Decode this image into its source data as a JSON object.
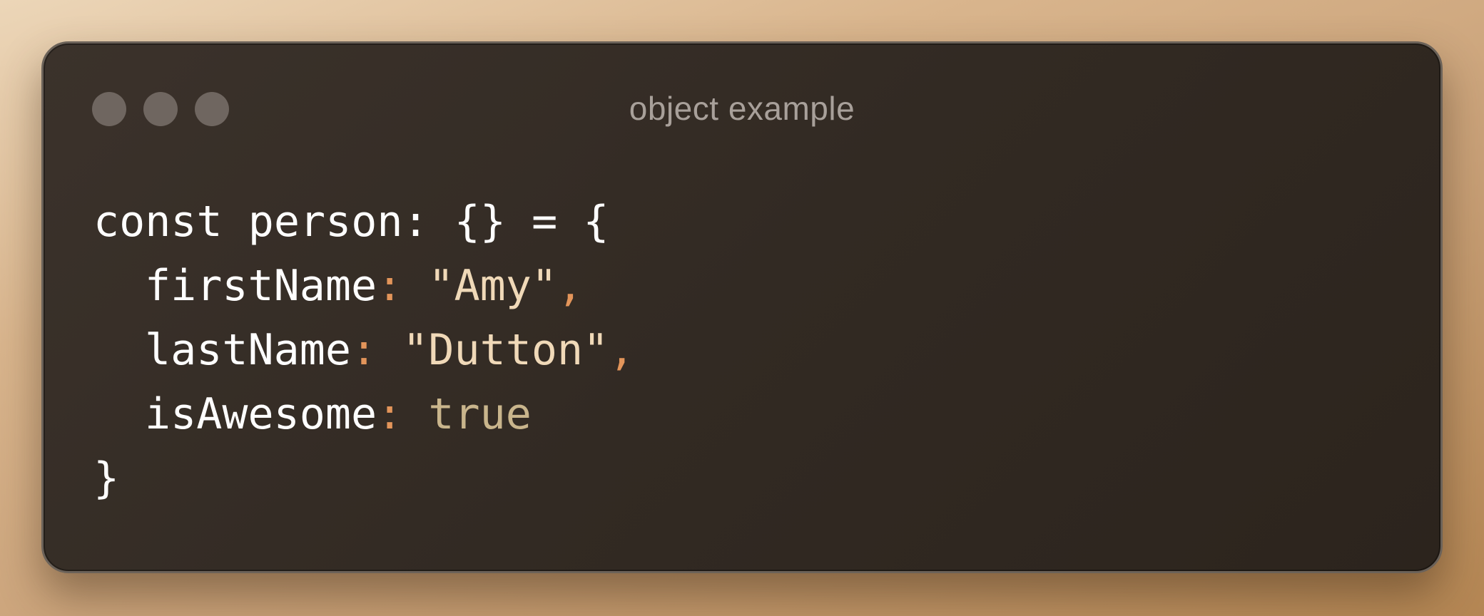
{
  "window": {
    "title": "object example",
    "traffic_lights": [
      "close-light",
      "minimize-light",
      "zoom-light"
    ]
  },
  "code": {
    "line1": "const person: {} = {",
    "line2_key": "firstName",
    "line2_colon": ":",
    "line2_value": "\"Amy\"",
    "line2_comma": ",",
    "line3_key": "lastName",
    "line3_colon": ":",
    "line3_value": "\"Dutton\"",
    "line3_comma": ",",
    "line4_key": "isAwesome",
    "line4_colon": ":",
    "line4_value": "true",
    "line5": "}"
  },
  "colors": {
    "background": "#d9b58d",
    "window": "#322a23",
    "punctuation": "#e3955a",
    "string": "#f0d9b8",
    "boolean": "#c9b58c",
    "text": "#ffffff",
    "title": "#a8a09a"
  }
}
